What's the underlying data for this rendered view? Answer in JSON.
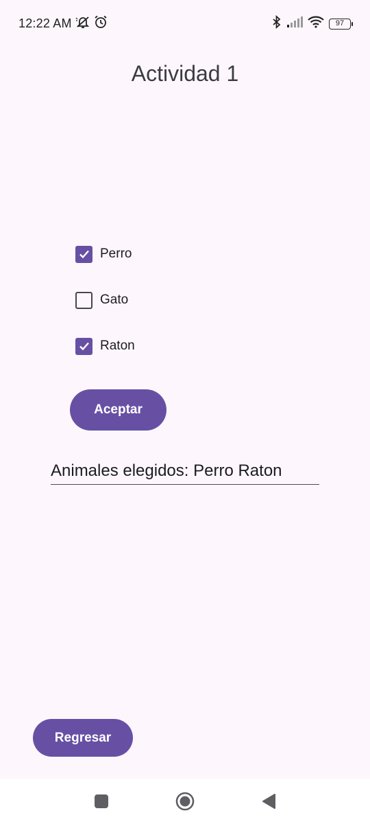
{
  "status_bar": {
    "time": "12:22 AM",
    "icons": [
      "mute-bell-icon",
      "alarm-icon",
      "bluetooth-icon",
      "signal-icon",
      "wifi-icon"
    ],
    "battery": "97"
  },
  "screen": {
    "title": "Actividad 1"
  },
  "checkboxes": [
    {
      "label": "Perro",
      "checked": true
    },
    {
      "label": "Gato",
      "checked": false
    },
    {
      "label": "Raton",
      "checked": true
    }
  ],
  "accept_button": {
    "label": "Aceptar"
  },
  "result": {
    "text": "Animales elegidos: Perro Raton"
  },
  "back_button": {
    "label": "Regresar"
  },
  "nav_bar": {
    "buttons": [
      "recents-square-icon",
      "home-circle-icon",
      "back-triangle-icon"
    ]
  },
  "colors": {
    "accent": "#6750a4",
    "background": "#fdf7fd",
    "navbar": "#ffffff"
  }
}
